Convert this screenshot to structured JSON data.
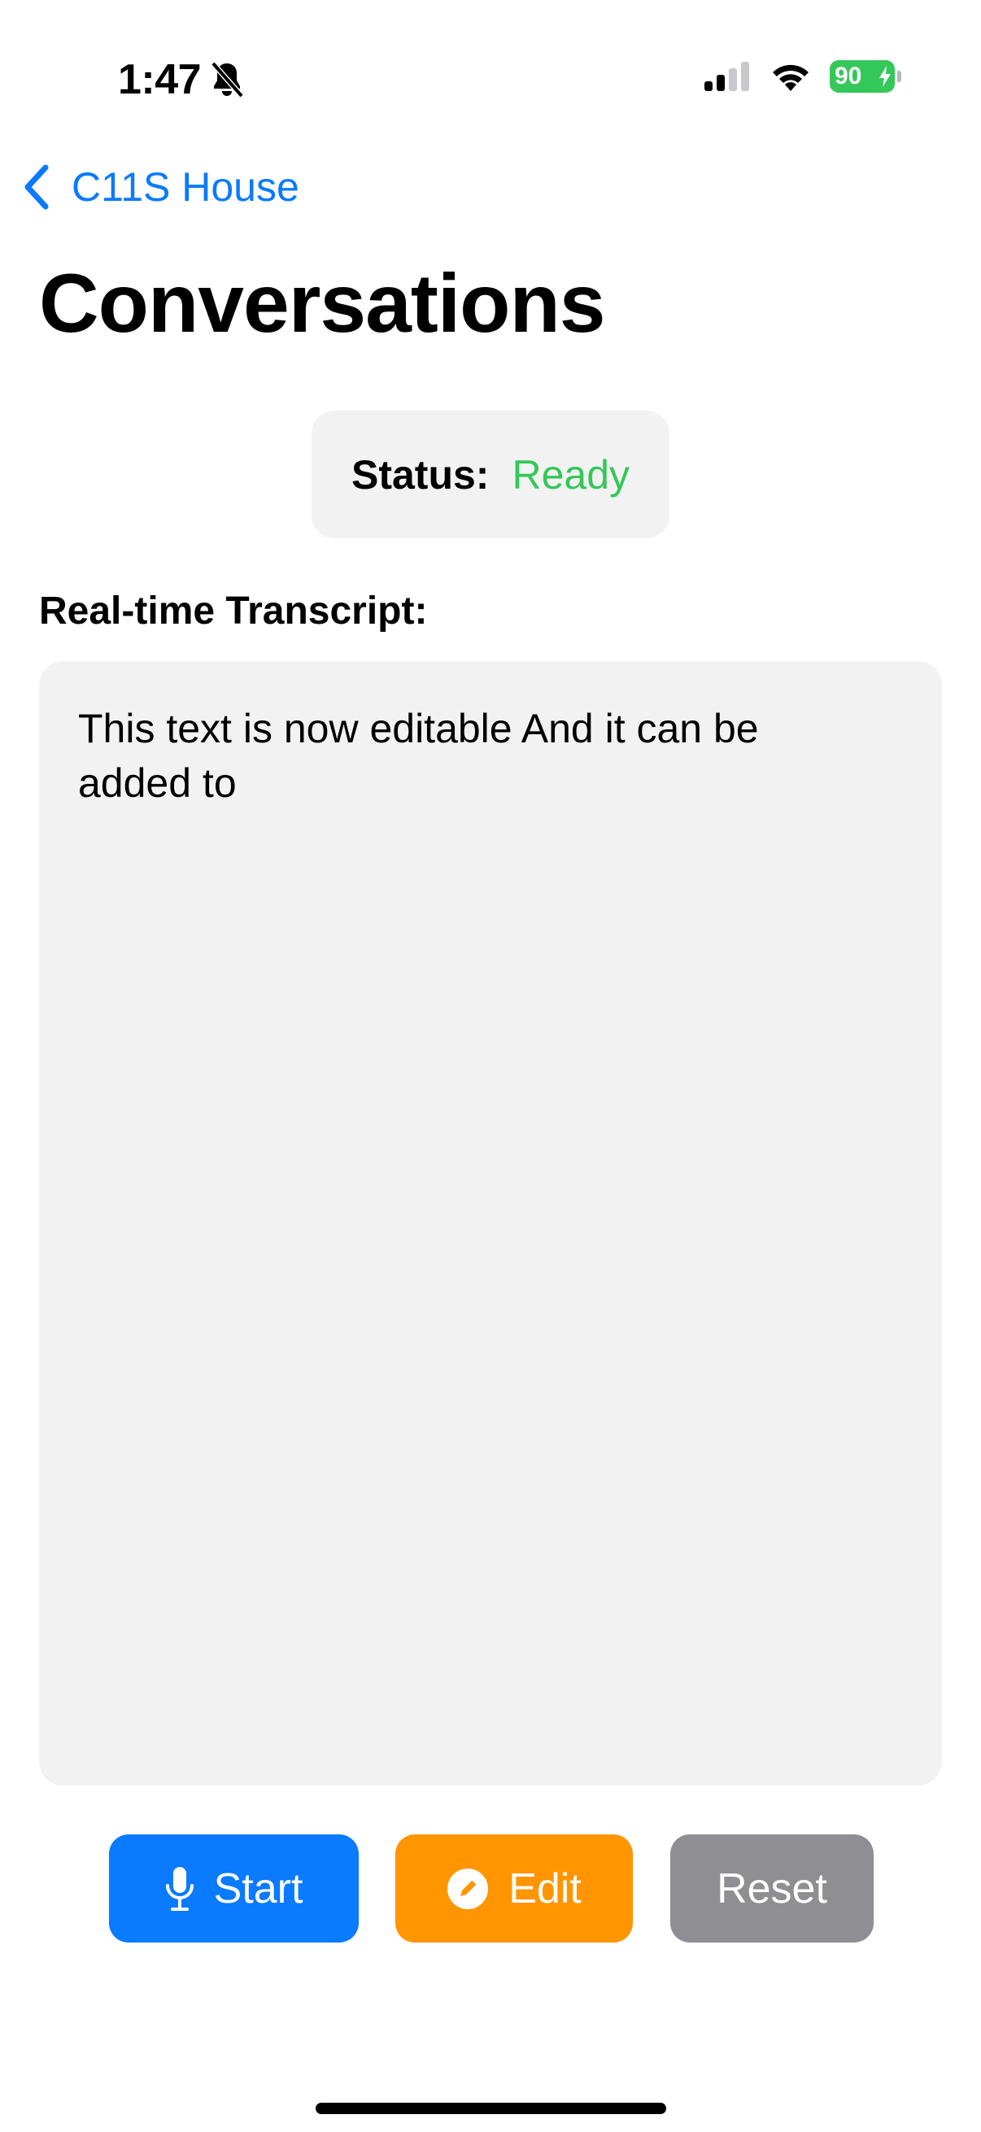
{
  "status_bar": {
    "time": "1:47",
    "battery_level": "90",
    "icons": [
      "silent-mode-icon",
      "cellular-signal-icon",
      "wifi-icon",
      "battery-charging-icon"
    ],
    "battery_color": "#34c759"
  },
  "nav": {
    "back_label": "C11S House",
    "title": "Conversations",
    "accent_color": "#0a7aff"
  },
  "status": {
    "label": "Status:",
    "value": "Ready",
    "value_color": "#34c759"
  },
  "transcript": {
    "heading": "Real-time Transcript:",
    "text": "This text is now editable And it can be added to"
  },
  "buttons": {
    "start": {
      "label": "Start",
      "icon": "microphone-icon",
      "color": "#0a7aff"
    },
    "edit": {
      "label": "Edit",
      "icon": "pencil-circle-icon",
      "color": "#ff9500"
    },
    "reset": {
      "label": "Reset",
      "color": "#8e8e93"
    }
  }
}
